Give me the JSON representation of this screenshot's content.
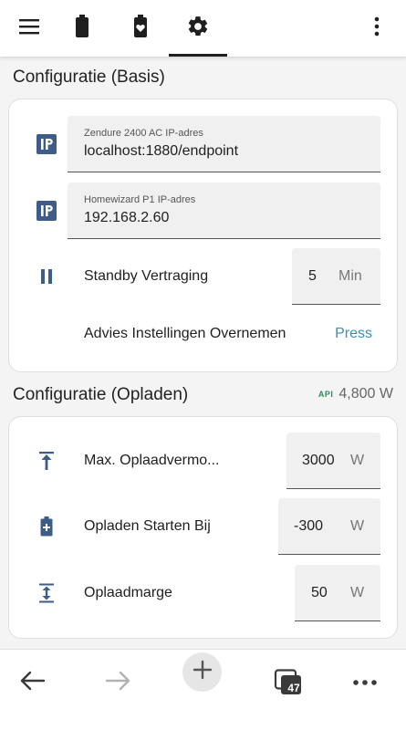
{
  "topbar": {
    "tabs": [
      {
        "name": "menu",
        "icon": "hamburger-menu-icon"
      },
      {
        "name": "battery",
        "icon": "battery-icon"
      },
      {
        "name": "battery-heart",
        "icon": "battery-heart-icon"
      },
      {
        "name": "settings",
        "icon": "gear-icon",
        "active": true
      },
      {
        "name": "more",
        "icon": "vertical-dots-icon"
      }
    ]
  },
  "basis": {
    "title": "Configuratie (Basis)",
    "zendure_ip": {
      "label": "Zendure 2400 AC IP-adres",
      "value": "localhost:1880/endpoint"
    },
    "p1_ip": {
      "label": "Homewizard P1 IP-adres",
      "value": "192.168.2.60"
    },
    "standby": {
      "label": "Standby Vertraging",
      "value": "5",
      "unit": "Min"
    },
    "advies": {
      "label": "Advies Instellingen Overnemen",
      "button": "Press"
    }
  },
  "opladen": {
    "title": "Configuratie (Opladen)",
    "badge_prefix": "API",
    "badge_value": "4,800 W",
    "max_power": {
      "label": "Max. Oplaadvermo...",
      "value": "3000",
      "unit": "W"
    },
    "start_at": {
      "label": "Opladen Starten Bij",
      "value": "-300",
      "unit": "W"
    },
    "margin": {
      "label": "Oplaadmarge",
      "value": "50",
      "unit": "W"
    }
  },
  "bottombar": {
    "tab_count": "47"
  },
  "colors": {
    "accent": "#3a8fb0",
    "icon": "#3e5c8a",
    "api_badge": "#2e8b57"
  }
}
